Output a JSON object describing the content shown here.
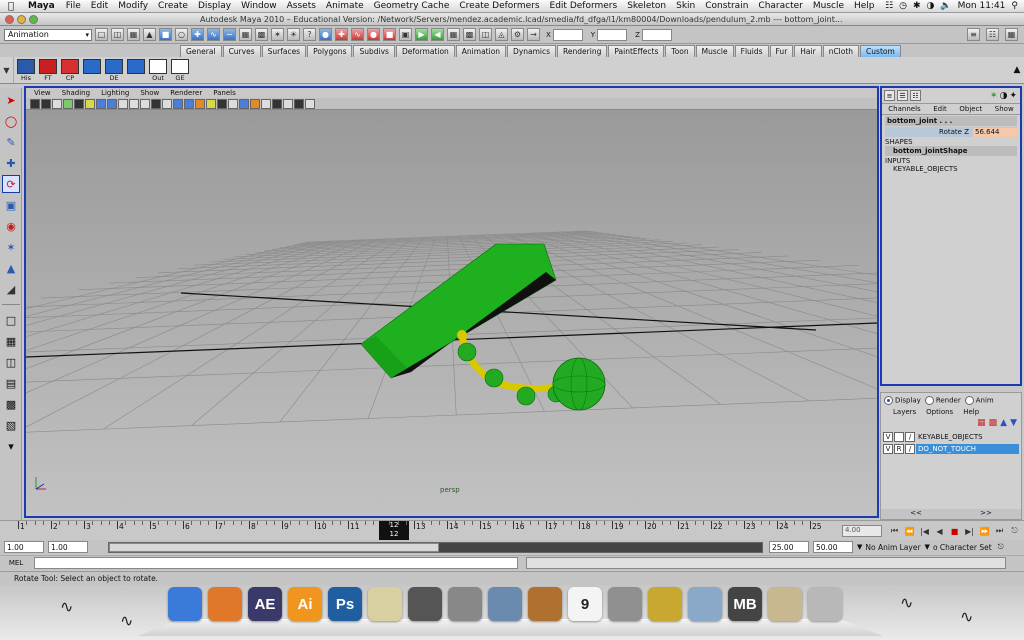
{
  "menubar": {
    "app": "Maya",
    "items": [
      "File",
      "Edit",
      "Modify",
      "Create",
      "Display",
      "Window",
      "Assets",
      "Animate",
      "Geometry Cache",
      "Create Deformers",
      "Edit Deformers",
      "Skeleton",
      "Skin",
      "Constrain",
      "Character",
      "Muscle",
      "Help"
    ],
    "clock": "Mon 11:41"
  },
  "titlebar": {
    "title": "Autodesk Maya 2010 – Educational Version: /Network/Servers/mendez.academic.lcad/smedia/fd_dfga/l1/km80004/Downloads/pendulum_2.mb  ---  bottom_joint..."
  },
  "statusline": {
    "menuset": "Animation",
    "x_label": "X",
    "y_label": "Y",
    "z_label": "Z"
  },
  "shelf_tabs": [
    "General",
    "Curves",
    "Surfaces",
    "Polygons",
    "Subdivs",
    "Deformation",
    "Animation",
    "Dynamics",
    "Rendering",
    "PaintEffects",
    "Toon",
    "Muscle",
    "Fluids",
    "Fur",
    "Hair",
    "nCloth",
    "Custom"
  ],
  "shelf_items": [
    "His",
    "FT",
    "CP",
    "",
    "DE",
    "",
    "Out",
    "GE"
  ],
  "panel_menu": [
    "View",
    "Shading",
    "Lighting",
    "Show",
    "Renderer",
    "Panels"
  ],
  "viewport": {
    "camera": "persp"
  },
  "channelbox": {
    "menu": [
      "Channels",
      "Edit",
      "Object",
      "Show"
    ],
    "node": "bottom_joint . . .",
    "attr_name": "Rotate Z",
    "attr_value": "56.644",
    "shapes_label": "SHAPES",
    "shape_name": "bottom_jointShape",
    "inputs_label": "INPUTS",
    "input_name": "KEYABLE_OBJECTS"
  },
  "layereditor": {
    "radios": [
      "Display",
      "Render",
      "Anim"
    ],
    "menu": [
      "Layers",
      "Options",
      "Help"
    ],
    "layers": [
      {
        "v": "V",
        "r": "",
        "name": "KEYABLE_OBJECTS"
      },
      {
        "v": "V",
        "r": "R",
        "name": "DO_NOT_TOUCH"
      }
    ],
    "prev": "<<",
    "next": ">>"
  },
  "timeslider": {
    "ticks": [
      "1",
      "2",
      "3",
      "4",
      "5",
      "6",
      "7",
      "8",
      "9",
      "10",
      "11",
      "12",
      "13",
      "14",
      "15",
      "16",
      "17",
      "18",
      "19",
      "20",
      "21",
      "22",
      "23",
      "24",
      "25"
    ],
    "current": "12",
    "current_field": "4.00"
  },
  "range": {
    "start": "1.00",
    "inner_start": "1.00",
    "inner_end": "25.00",
    "end": "50.00",
    "anim_layer": "No Anim Layer",
    "character_set": "o Character Set"
  },
  "cmdline": {
    "label": "MEL"
  },
  "helpline": {
    "text": "Rotate Tool: Select an object to rotate."
  },
  "dock": {
    "items": [
      {
        "name": "finder",
        "label": "",
        "color": "#3a7ad8"
      },
      {
        "name": "firefox",
        "label": "",
        "color": "#e0782a"
      },
      {
        "name": "after-effects",
        "label": "AE",
        "color": "#3a3a6a"
      },
      {
        "name": "illustrator",
        "label": "Ai",
        "color": "#f0961e"
      },
      {
        "name": "photoshop",
        "label": "Ps",
        "color": "#1f5ea0"
      },
      {
        "name": "pencil",
        "label": "",
        "color": "#d8d0a0"
      },
      {
        "name": "maya",
        "label": "",
        "color": "#555555"
      },
      {
        "name": "camera",
        "label": "",
        "color": "#888888"
      },
      {
        "name": "iphoto",
        "label": "",
        "color": "#6a8ab0"
      },
      {
        "name": "garageband",
        "label": "",
        "color": "#b07030"
      },
      {
        "name": "ical",
        "label": "9",
        "color": "#f4f4f4"
      },
      {
        "name": "preferences",
        "label": "",
        "color": "#909090"
      },
      {
        "name": "lock",
        "label": "",
        "color": "#c8a830"
      },
      {
        "name": "folder",
        "label": "",
        "color": "#8aa8c8"
      },
      {
        "name": "maya-doc",
        "label": "MB",
        "color": "#444444"
      },
      {
        "name": "preview",
        "label": "",
        "color": "#c8b890"
      },
      {
        "name": "trash",
        "label": "",
        "color": "#b8b8b8"
      }
    ]
  }
}
